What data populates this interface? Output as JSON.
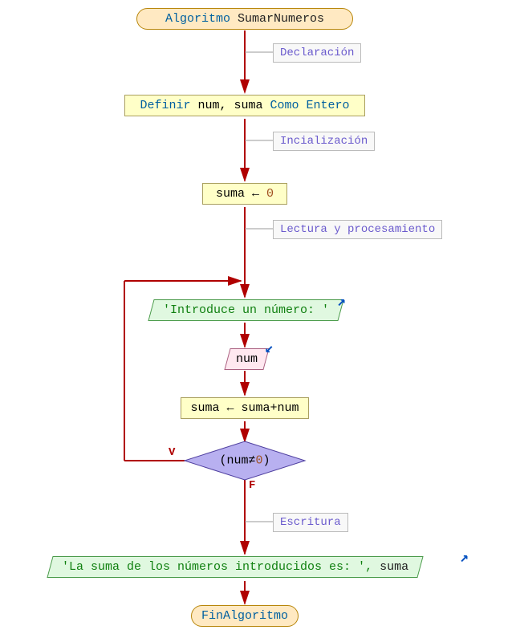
{
  "terminal_start_kw": "Algoritmo",
  "terminal_start_name": " SumarNumeros",
  "terminal_end": "FinAlgoritmo",
  "declare": {
    "kw1": "Definir ",
    "vars": "num, suma",
    "kw2": " Como ",
    "type": "Entero"
  },
  "init": {
    "var": "suma",
    "op": " ← ",
    "val": "0"
  },
  "prompt": "'Introduce un número: '",
  "read_var": "num",
  "assign": {
    "var": "suma",
    "op": " ← ",
    "expr": "suma+num"
  },
  "cond": {
    "lp": "(",
    "var": "num",
    "op": "≠",
    "val": "0",
    "rp": ")"
  },
  "output": {
    "str": "'La suma de los números introducidos es: '",
    "sep": ", ",
    "var": "suma"
  },
  "comments": {
    "c1": "Declaración",
    "c2": "Incialización",
    "c3": "Lectura y procesamiento",
    "c4": "Escritura"
  },
  "branches": {
    "true": "V",
    "false": "F"
  }
}
